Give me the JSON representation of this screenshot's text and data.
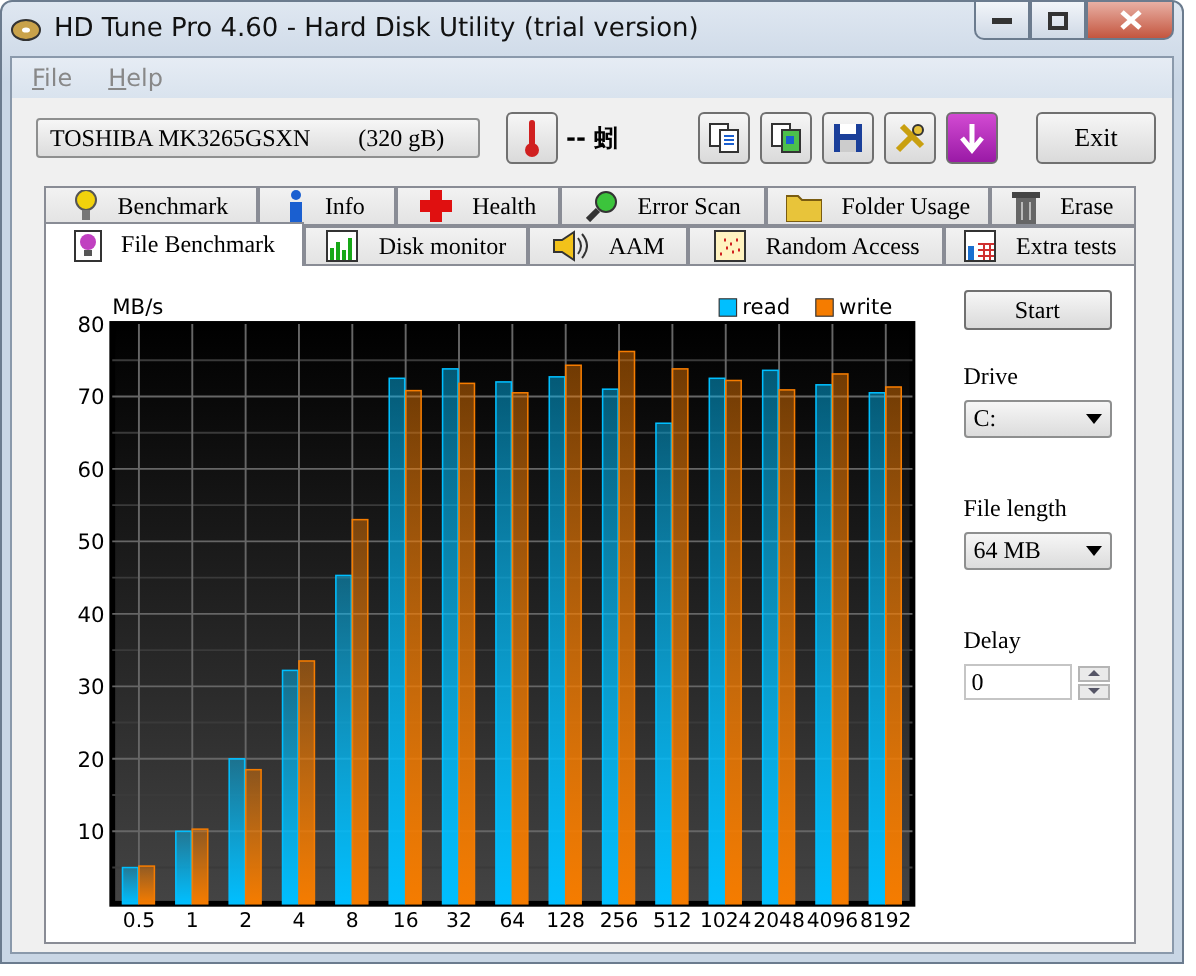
{
  "window": {
    "title": "HD Tune Pro 4.60 - Hard Disk Utility (trial version)"
  },
  "menu": [
    {
      "label": "File"
    },
    {
      "label": "Help"
    }
  ],
  "toolbar": {
    "drive_model": "TOSHIBA MK3265GSXN",
    "drive_size": "(320 gB)",
    "temperature": "-- 蚓",
    "exit": "Exit"
  },
  "tab_rows": [
    [
      {
        "label": "Benchmark",
        "selected": false
      },
      {
        "label": "Info",
        "selected": false
      },
      {
        "label": "Health",
        "selected": false
      },
      {
        "label": "Error Scan",
        "selected": false
      },
      {
        "label": "Folder Usage",
        "selected": false
      },
      {
        "label": "Erase",
        "selected": false
      }
    ],
    [
      {
        "label": "File Benchmark",
        "selected": true
      },
      {
        "label": "Disk monitor",
        "selected": false
      },
      {
        "label": "AAM",
        "selected": false
      },
      {
        "label": "Random Access",
        "selected": false
      },
      {
        "label": "Extra tests",
        "selected": false
      }
    ]
  ],
  "benchmark": {
    "chart_data": {
      "type": "bar",
      "ylabel": "MB/s",
      "categories": [
        "0.5",
        "1",
        "2",
        "4",
        "8",
        "16",
        "32",
        "64",
        "128",
        "256",
        "512",
        "1024",
        "2048",
        "4096",
        "8192"
      ],
      "series": [
        {
          "name": "read",
          "color": "#00bfff",
          "values": [
            5,
            10,
            20,
            32.2,
            45.3,
            72.5,
            73.8,
            72,
            72.7,
            71,
            66.3,
            72.5,
            73.6,
            71.6,
            70.5
          ]
        },
        {
          "name": "write",
          "color": "#f57c00",
          "values": [
            5.2,
            10.3,
            18.5,
            33.5,
            53,
            70.8,
            71.8,
            70.5,
            74.3,
            76.2,
            73.8,
            72.2,
            70.9,
            73.1,
            71.3
          ]
        }
      ],
      "ylim": [
        0,
        80
      ],
      "yticks": [
        10,
        20,
        30,
        40,
        50,
        60,
        70,
        80
      ],
      "grid": true,
      "legend": true
    }
  },
  "settings": {
    "start": "Start",
    "drive_label": "Drive",
    "drive_value": "C:",
    "file_length_label": "File length",
    "file_length_value": "64 MB",
    "delay_label": "Delay",
    "delay_value": "0"
  }
}
